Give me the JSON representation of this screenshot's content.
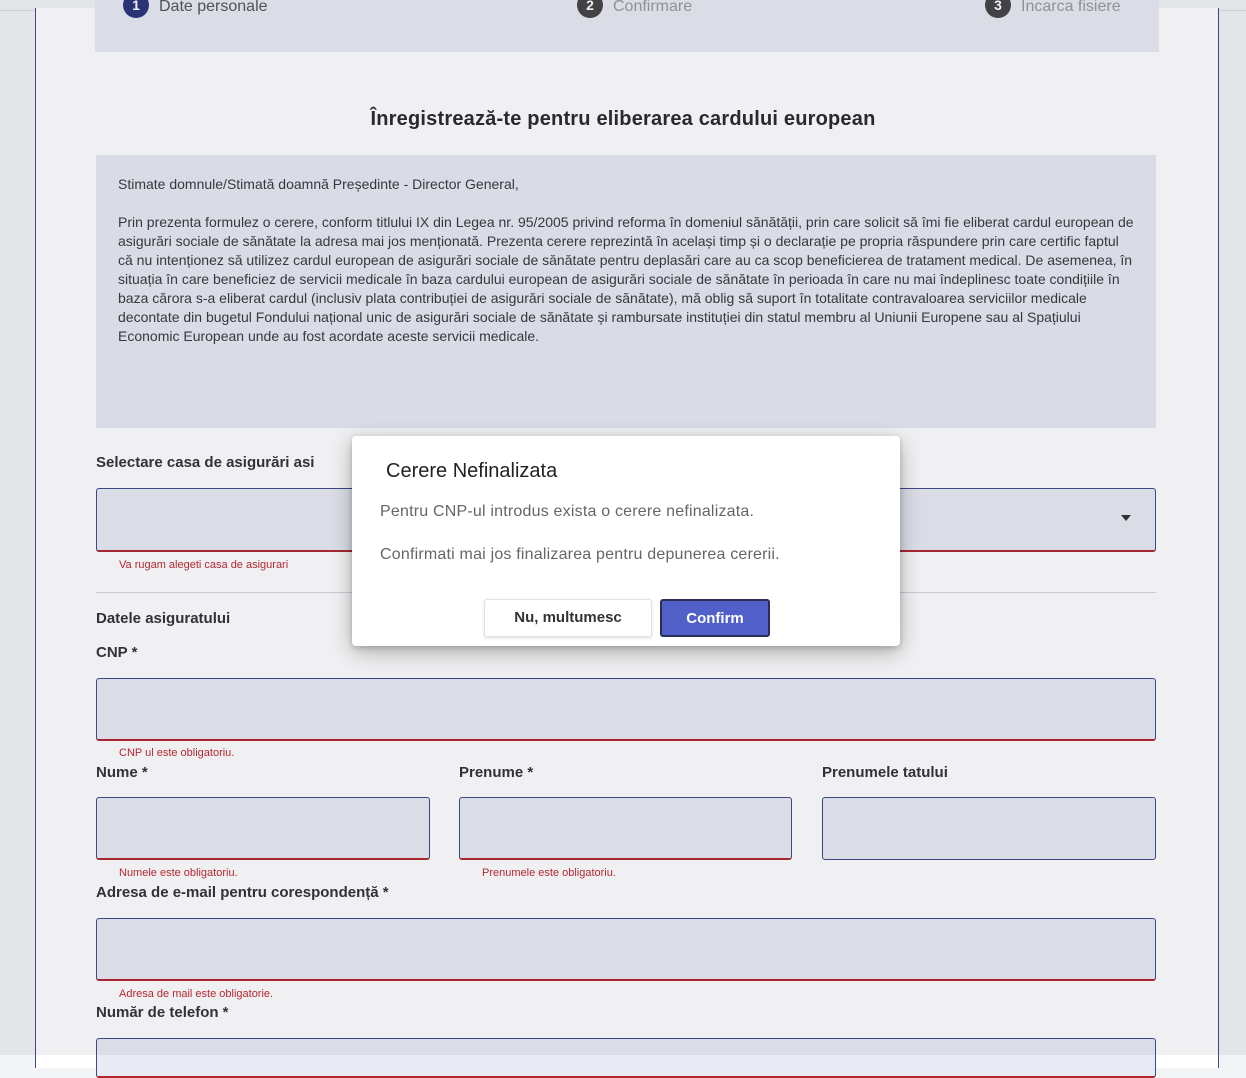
{
  "stepper": {
    "steps": [
      {
        "number": "1",
        "label": "Date personale"
      },
      {
        "number": "2",
        "label": "Confirmare"
      },
      {
        "number": "3",
        "label": "Incarca fisiere"
      }
    ]
  },
  "page": {
    "title": "Înregistrează-te pentru eliberarea cardului european"
  },
  "declaration": {
    "salutation": "Stimate domnule/Stimată doamnă Președinte - Director General,",
    "body": "Prin prezenta formulez o cerere, conform titlului IX din Legea nr. 95/2005 privind reforma în domeniul sănătății, prin care solicit să îmi fie eliberat cardul european de asigurări sociale de sănătate la adresa mai jos menționată. Prezenta cerere reprezintă în același timp și o declarație pe propria răspundere prin care certific faptul că nu intenționez să utilizez cardul european de asigurări sociale de sănătate pentru deplasări care au ca scop beneficierea de tratament medical. De asemenea, în situația în care beneficiez de servicii medicale în baza cardului european de asigurări sociale de sănătate în perioada în care nu mai îndeplinesc toate condițiile în baza cărora s-a eliberat cardul (inclusiv plata contribuției de asigurări sociale de sănătate), mă oblig să suport în totalitate contravaloarea serviciilor medicale decontate din bugetul Fondului național unic de asigurări sociale de sănătate și rambursate instituției din statul membru al Uniunii Europene sau al Spațiului Economic European unde au fost acordate aceste servicii medicale."
  },
  "form": {
    "casa_label": "Selectare casa de asigurări asi",
    "casa_error": "Va rugam alegeti casa de asigurari",
    "section_label": "Datele asiguratului",
    "cnp_label": "CNP *",
    "cnp_error": "CNP ul este obligatoriu.",
    "nume_label": "Nume *",
    "nume_error": "Numele este obligatoriu.",
    "prenume_label": "Prenume *",
    "prenume_error": "Prenumele este obligatoriu.",
    "tata_label": "Prenumele tatului",
    "email_label": "Adresa de e-mail pentru corespondență *",
    "email_error": "Adresa de mail este obligatorie.",
    "telefon_label": "Număr de telefon *"
  },
  "dialog": {
    "title": "Cerere Nefinalizata",
    "message1": "Pentru CNP-ul introdus exista o cerere nefinalizata.",
    "message2": "Confirmati mai jos finalizarea pentru depunerea cererii.",
    "cancel_label": "Nu, multumesc",
    "confirm_label": "Confirm"
  },
  "colors": {
    "accent": "#3f4a8a",
    "primary_button": "#5060c8",
    "error": "#c0282f",
    "step_inactive": "#444444"
  }
}
